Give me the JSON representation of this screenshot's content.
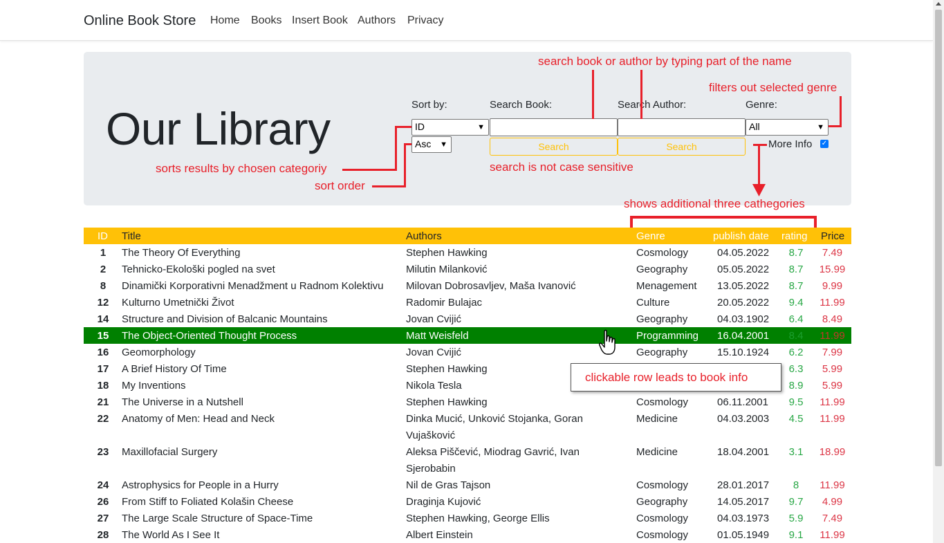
{
  "nav": {
    "brand": "Online Book Store",
    "links": [
      "Home",
      "Books",
      "Insert Book",
      "Authors",
      "Privacy"
    ]
  },
  "hero": {
    "title": "Our Library",
    "sort_label": "Sort by:",
    "sort_value": "ID",
    "order_value": "Asc",
    "search_book_label": "Search Book:",
    "search_author_label": "Search Author:",
    "genre_label": "Genre:",
    "genre_value": "All",
    "search_button": "Search",
    "search_author_button": "Search",
    "more_info_label": "More Info",
    "more_info_checked": true
  },
  "annotations": {
    "search": "search book or author by typing part of the name",
    "genre": "filters out selected genre",
    "sort": "sorts results by chosen categoriy",
    "order": "sort order",
    "case": "search is not case sensitive",
    "more": "shows additional three cathegories",
    "row": "clickable row leads to book info"
  },
  "table": {
    "headers": [
      "ID",
      "Title",
      "Authors",
      "Genre",
      "publish date",
      "rating",
      "Price"
    ],
    "rows": [
      {
        "id": "1",
        "title": "The Theory Of Everything",
        "authors": "Stephen Hawking",
        "authors2": "",
        "genre": "Cosmology",
        "date": "04.05.2022",
        "rating": "8.7",
        "price": "7.49"
      },
      {
        "id": "2",
        "title": "Tehnicko-Ekološki pogled na svet",
        "authors": "Milutin Milanković",
        "authors2": "",
        "genre": "Geography",
        "date": "05.05.2022",
        "rating": "8.7",
        "price": "15.99"
      },
      {
        "id": "8",
        "title": "Dinamički Korporativni Menadžment u Radnom Kolektivu",
        "authors": "Milovan Dobrosavljev, Maša Ivanović",
        "authors2": "",
        "genre": "Menagement",
        "date": "13.05.2022",
        "rating": "8.7",
        "price": "9.99"
      },
      {
        "id": "12",
        "title": "Kulturno Umetnički Život",
        "authors": "Radomir Bulajac",
        "authors2": "",
        "genre": "Culture",
        "date": "20.05.2022",
        "rating": "9.4",
        "price": "11.99"
      },
      {
        "id": "14",
        "title": "Structure and Division of Balcanic Mountains",
        "authors": "Jovan Cvijić",
        "authors2": "",
        "genre": "Geography",
        "date": "04.03.1902",
        "rating": "6.4",
        "price": "8.49"
      },
      {
        "id": "15",
        "title": "The Object-Oriented Thought Process",
        "authors": "Matt Weisfeld",
        "authors2": "",
        "genre": "Programming",
        "date": "16.04.2001",
        "rating": "8.4",
        "price": "11.99"
      },
      {
        "id": "16",
        "title": "Geomorphology",
        "authors": "Jovan Cvijić",
        "authors2": "",
        "genre": "Geography",
        "date": "15.10.1924",
        "rating": "6.2",
        "price": "7.99"
      },
      {
        "id": "17",
        "title": "A Brief History Of Time",
        "authors": "Stephen Hawking",
        "authors2": "",
        "genre": "",
        "date": "",
        "rating": "6.3",
        "price": "5.99"
      },
      {
        "id": "18",
        "title": "My Inventions",
        "authors": "Nikola Tesla",
        "authors2": "",
        "genre": "",
        "date": "",
        "rating": "8.9",
        "price": "5.99"
      },
      {
        "id": "21",
        "title": "The Universe in a Nutshell",
        "authors": "Stephen Hawking",
        "authors2": "",
        "genre": "Cosmology",
        "date": "06.11.2001",
        "rating": "9.5",
        "price": "11.99"
      },
      {
        "id": "22",
        "title": "Anatomy of Men: Head and Neck",
        "authors": "Dinka Mucić, Unković Stojanka, Goran",
        "authors2": "Vujašković",
        "genre": "Medicine",
        "date": "04.03.2003",
        "rating": "4.5",
        "price": "11.99"
      },
      {
        "id": "23",
        "title": "Maxillofacial Surgery",
        "authors": "Aleksa Piščević, Miodrag Gavrić, Ivan",
        "authors2": "Sjerobabin",
        "genre": "Medicine",
        "date": "18.04.2001",
        "rating": "3.1",
        "price": "18.99"
      },
      {
        "id": "24",
        "title": "Astrophysics for People in a Hurry",
        "authors": "Nil de Gras Tajson",
        "authors2": "",
        "genre": "Cosmology",
        "date": "28.01.2017",
        "rating": "8",
        "price": "11.99"
      },
      {
        "id": "26",
        "title": "From Stiff to Foliated Kolašin Cheese",
        "authors": "Draginja Kujović",
        "authors2": "",
        "genre": "Geography",
        "date": "14.05.2017",
        "rating": "9.7",
        "price": "4.99"
      },
      {
        "id": "27",
        "title": "The Large Scale Structure of Space-Time",
        "authors": "Stephen Hawking, George Ellis",
        "authors2": "",
        "genre": "Cosmology",
        "date": "04.03.1973",
        "rating": "5.9",
        "price": "7.49"
      },
      {
        "id": "28",
        "title": "The World As I See It",
        "authors": "Albert Einstein",
        "authors2": "",
        "genre": "Cosmology",
        "date": "01.05.1949",
        "rating": "9.1",
        "price": "11.99"
      }
    ]
  },
  "colors": {
    "accent": "#ffc107",
    "selected_row": "#008000",
    "annotation": "#e8202a",
    "rating": "#28a745",
    "price": "#dc3545"
  }
}
